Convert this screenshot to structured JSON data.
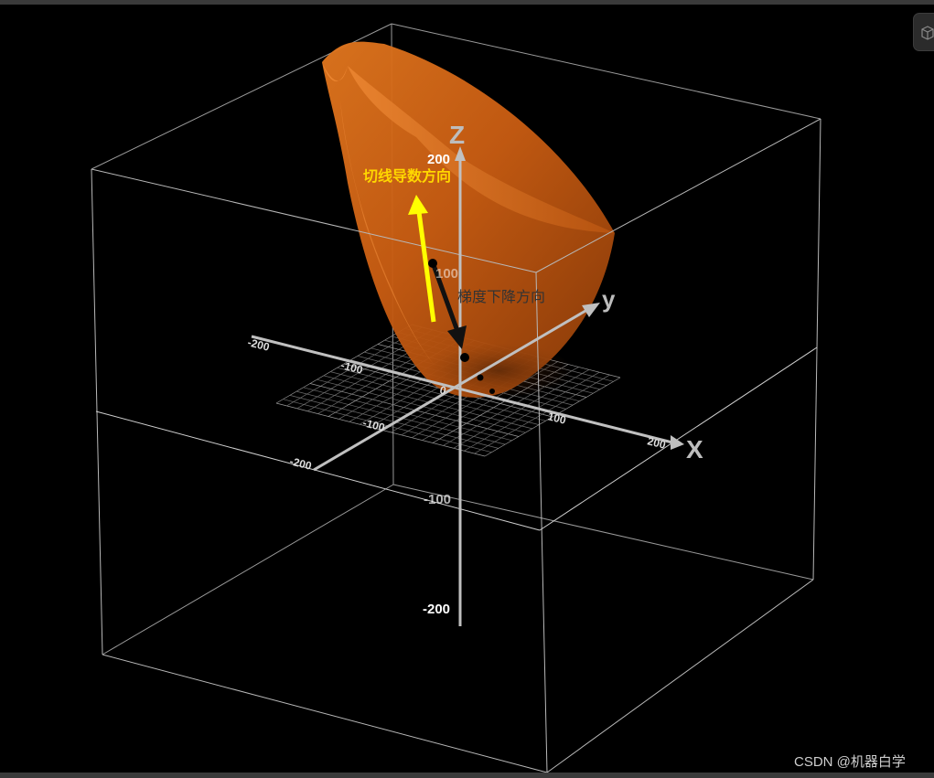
{
  "app": {
    "watermark": "CSDN @机器白学",
    "view_cube_icon": "cube-icon"
  },
  "chart_data": {
    "type": "surface3d",
    "title": "",
    "surface": {
      "equation": "z = (x^2 + y^2) / 100",
      "color": "#d96a1a",
      "opacity": 0.9
    },
    "axes": {
      "x": {
        "label": "X",
        "range": [
          -200,
          200
        ],
        "tick_labels": [
          "-200",
          "-100",
          "0",
          "100",
          "200"
        ]
      },
      "y": {
        "label": "y",
        "range": [
          -200,
          200
        ]
      },
      "z": {
        "label": "Z",
        "range": [
          -200,
          200
        ],
        "tick_labels": [
          "-200",
          "-100",
          "100",
          "200"
        ]
      }
    },
    "grid": true,
    "bounding_box": true,
    "annotations": [
      {
        "text": "切线导数方向",
        "color": "#ffd700"
      },
      {
        "text": "梯度下降方向",
        "color": "#333333"
      }
    ],
    "arrows": [
      {
        "name": "tangent-derivative-arrow",
        "color": "#ffff00"
      },
      {
        "name": "gradient-descent-arrow",
        "color": "#111111"
      }
    ],
    "descent_points_count": 4
  }
}
